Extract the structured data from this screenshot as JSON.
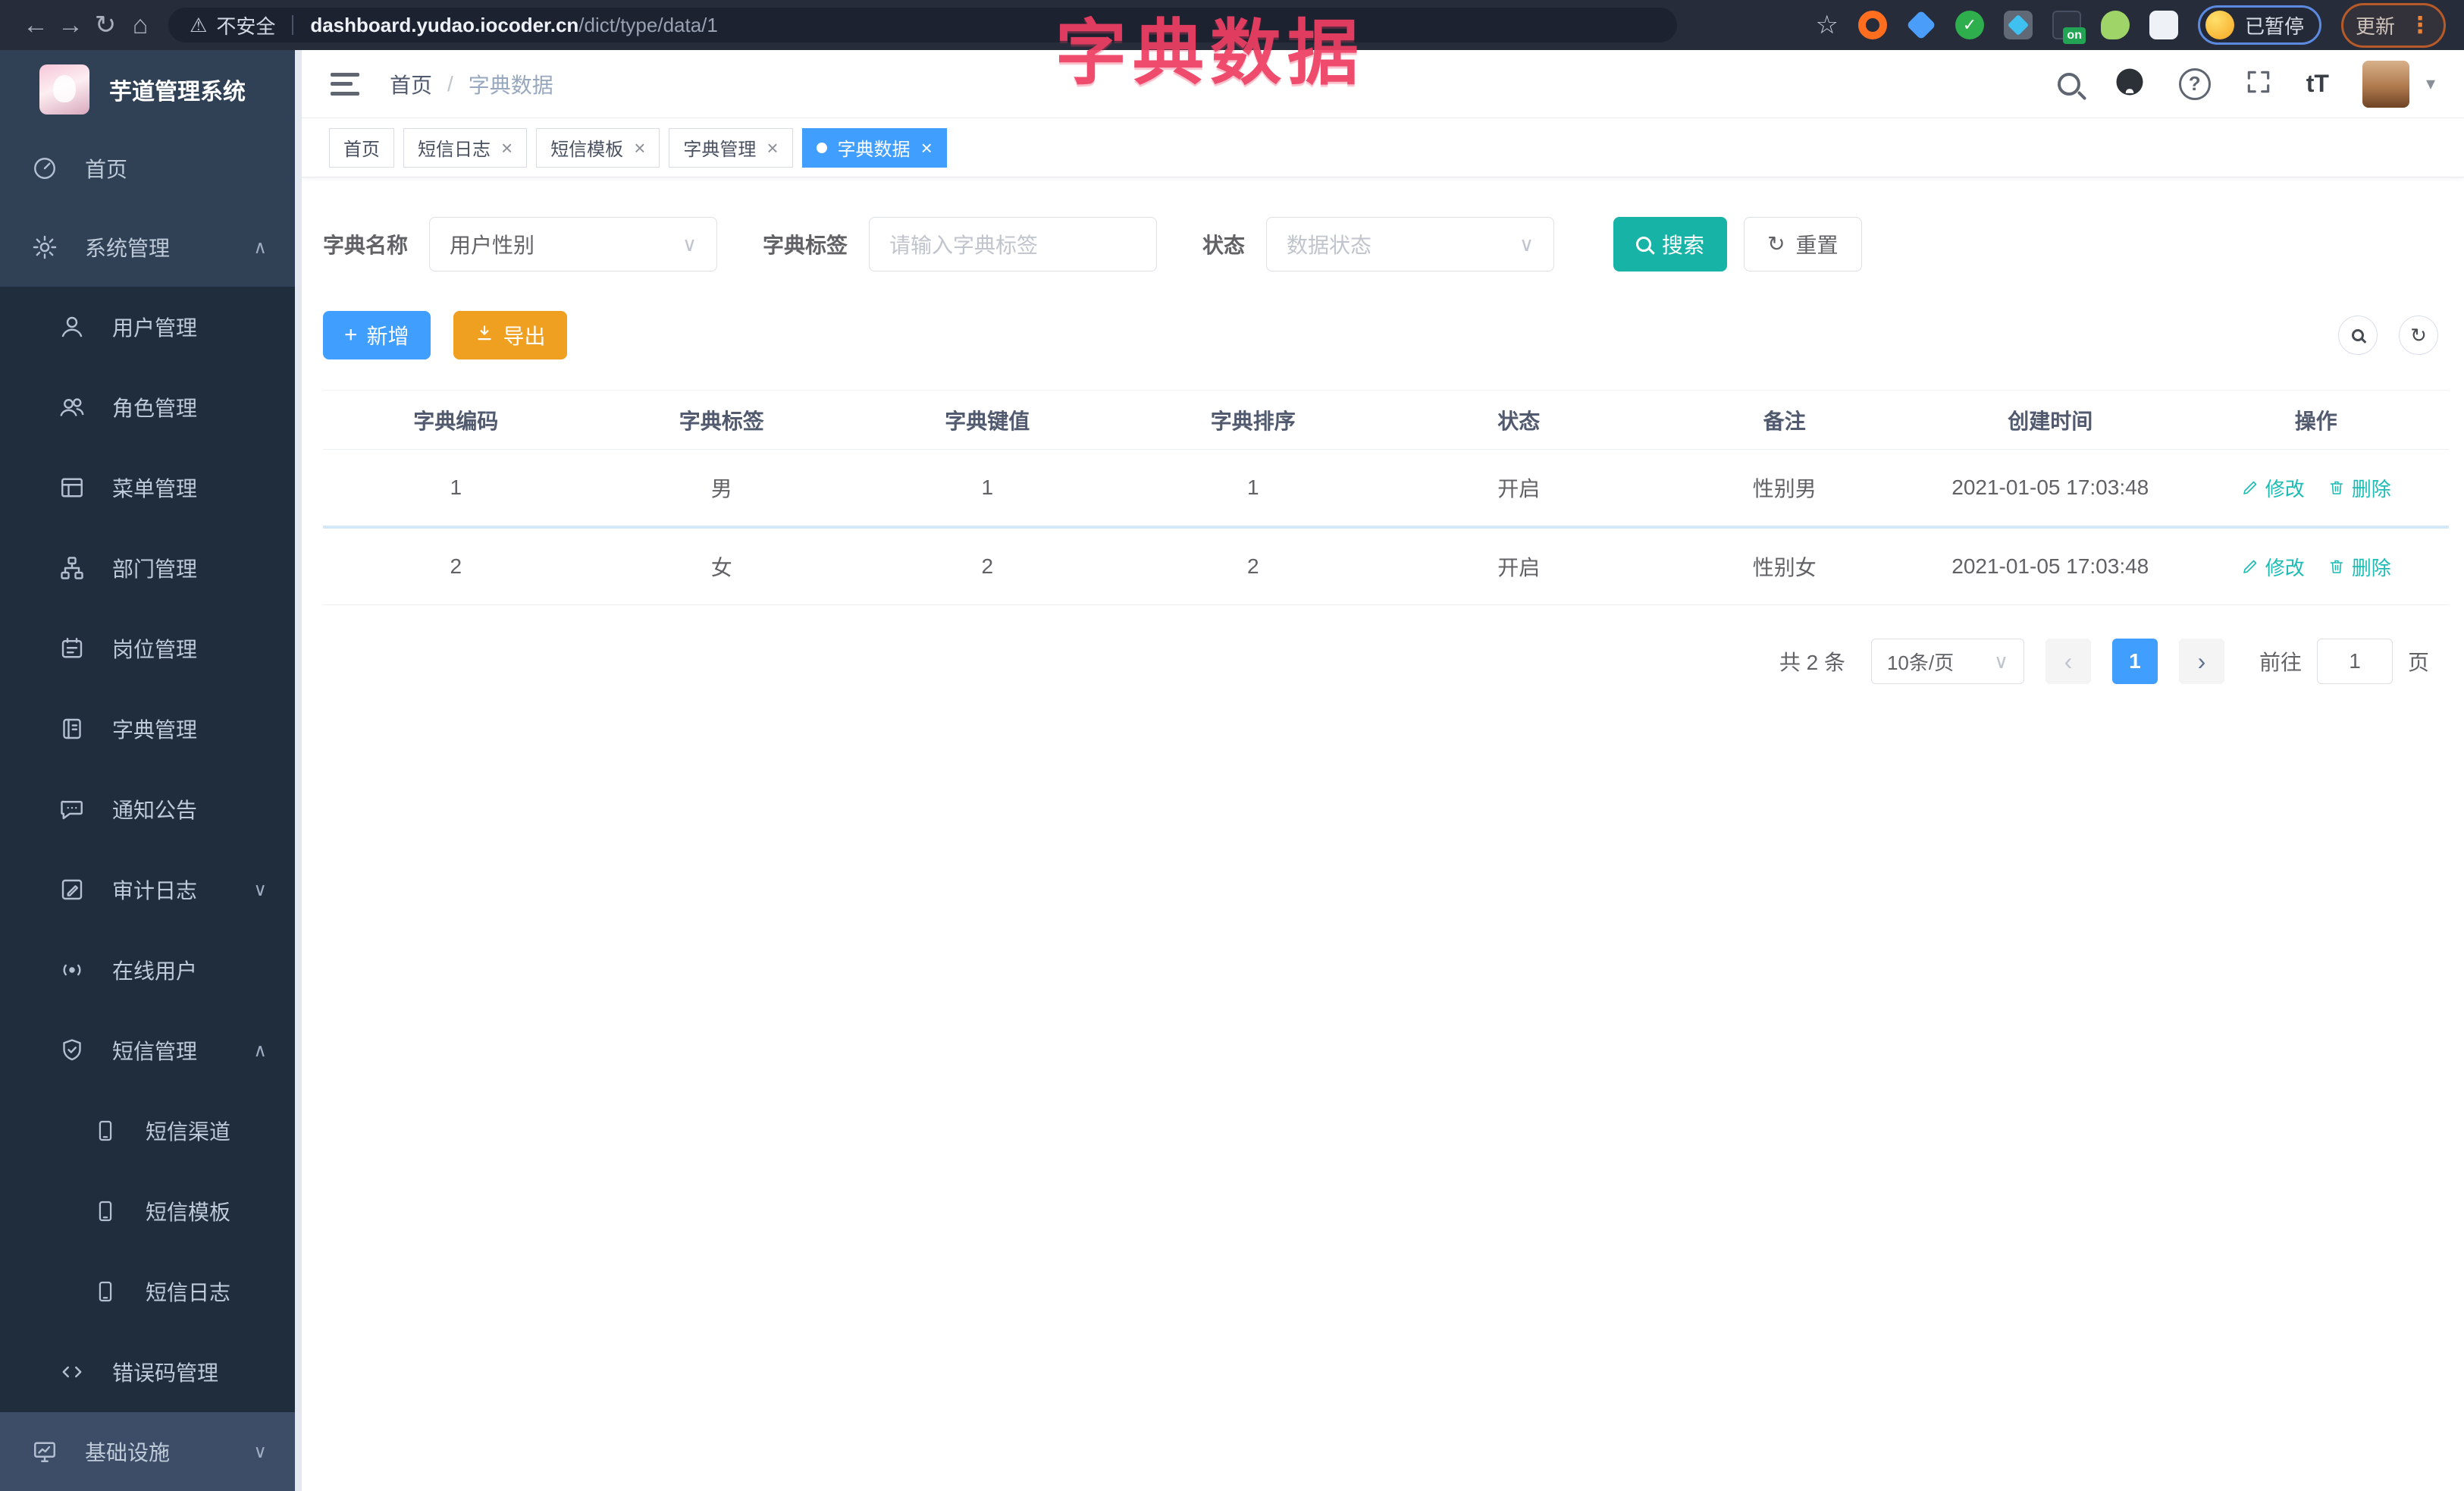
{
  "browser": {
    "security_label": "不安全",
    "url_host": "dashboard.yudao.iocoder.cn",
    "url_path": "/dict/type/data/1",
    "extension_badge": "on",
    "profile_label": "已暂停",
    "update_label": "更新"
  },
  "overlay_title": "字典数据",
  "sidebar": {
    "app_title": "芋道管理系统",
    "items": [
      {
        "label": "首页"
      },
      {
        "label": "系统管理"
      },
      {
        "label": "用户管理"
      },
      {
        "label": "角色管理"
      },
      {
        "label": "菜单管理"
      },
      {
        "label": "部门管理"
      },
      {
        "label": "岗位管理"
      },
      {
        "label": "字典管理"
      },
      {
        "label": "通知公告"
      },
      {
        "label": "审计日志"
      },
      {
        "label": "在线用户"
      },
      {
        "label": "短信管理"
      },
      {
        "label": "短信渠道"
      },
      {
        "label": "短信模板"
      },
      {
        "label": "短信日志"
      },
      {
        "label": "错误码管理"
      },
      {
        "label": "基础设施"
      }
    ]
  },
  "header": {
    "breadcrumb_home": "首页",
    "breadcrumb_sep": "/",
    "breadcrumb_current": "字典数据",
    "font_size_icon_label": "tT"
  },
  "tabs": [
    {
      "label": "首页"
    },
    {
      "label": "短信日志"
    },
    {
      "label": "短信模板"
    },
    {
      "label": "字典管理"
    },
    {
      "label": "字典数据"
    }
  ],
  "filters": {
    "dict_name_label": "字典名称",
    "dict_name_value": "用户性别",
    "dict_label_label": "字典标签",
    "dict_label_placeholder": "请输入字典标签",
    "status_label": "状态",
    "status_placeholder": "数据状态",
    "search_label": "搜索",
    "reset_label": "重置"
  },
  "toolbar": {
    "add_label": "新增",
    "export_label": "导出"
  },
  "table": {
    "columns": [
      "字典编码",
      "字典标签",
      "字典键值",
      "字典排序",
      "状态",
      "备注",
      "创建时间",
      "操作"
    ],
    "edit_label": "修改",
    "delete_label": "删除",
    "rows": [
      {
        "code": "1",
        "label": "男",
        "value": "1",
        "sort": "1",
        "status": "开启",
        "remark": "性别男",
        "created": "2021-01-05 17:03:48"
      },
      {
        "code": "2",
        "label": "女",
        "value": "2",
        "sort": "2",
        "status": "开启",
        "remark": "性别女",
        "created": "2021-01-05 17:03:48"
      }
    ]
  },
  "pagination": {
    "total_text": "共 2 条",
    "page_size": "10条/页",
    "current_page": "1",
    "goto_label": "前往",
    "goto_value": "1",
    "page_suffix": "页"
  },
  "colors": {
    "primary": "#409EFF",
    "teal": "#17B3A6",
    "orange": "#F0A020",
    "sidebar_bg": "#304156",
    "submenu_bg": "#1F2D3D",
    "overlay_pink": "#EE3F63"
  }
}
